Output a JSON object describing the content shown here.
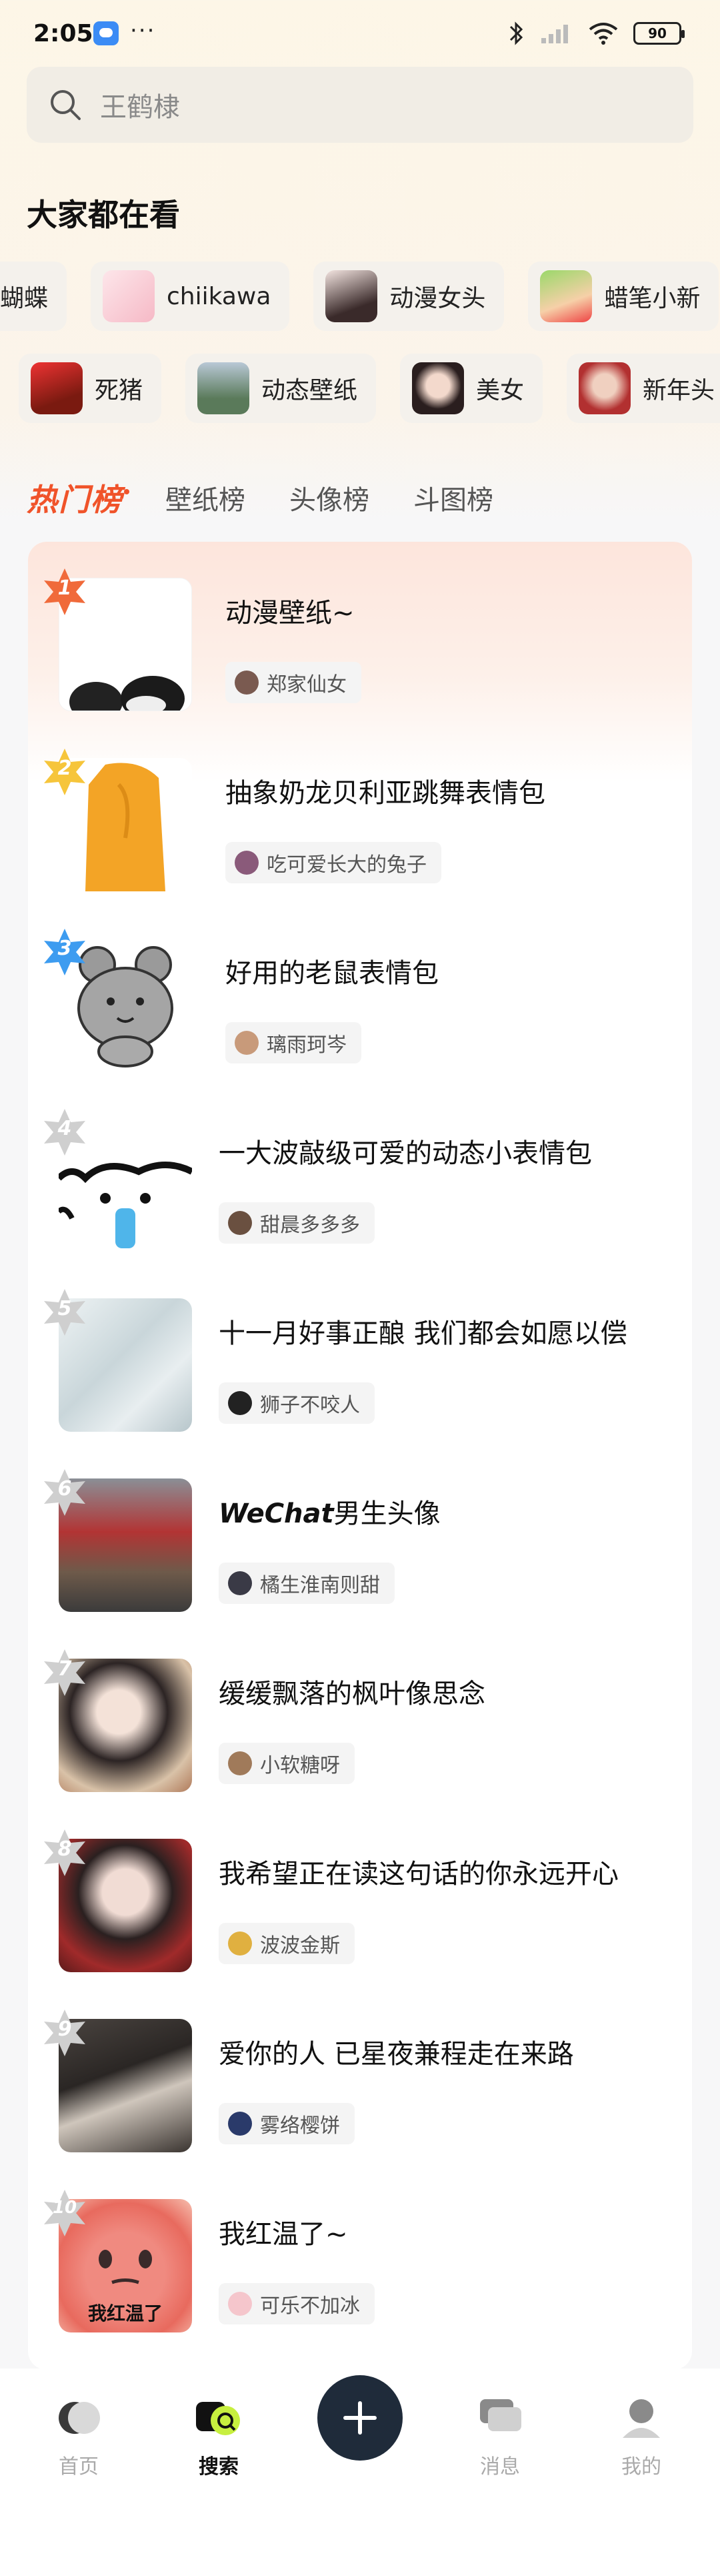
{
  "status_bar": {
    "time": "2:05",
    "dots": "···",
    "battery": "90"
  },
  "search": {
    "placeholder": "王鹤棣"
  },
  "section_title": "大家都在看",
  "chips_row1": [
    {
      "label": "蝴蝶"
    },
    {
      "label": "chiikawa"
    },
    {
      "label": "动漫女头"
    },
    {
      "label": "蜡笔小新"
    }
  ],
  "chips_row2": [
    {
      "label": "死猪"
    },
    {
      "label": "动态壁纸"
    },
    {
      "label": "美女"
    },
    {
      "label": "新年头"
    }
  ],
  "tabs": {
    "hot": "热门榜",
    "items": [
      "壁纸榜",
      "头像榜",
      "斗图榜"
    ]
  },
  "ranking": [
    {
      "rank": "1",
      "title": "动漫壁纸~",
      "author": "郑家仙女",
      "badge_color": "#f06a3a"
    },
    {
      "rank": "2",
      "title": "抽象奶龙贝利亚跳舞表情包",
      "author": "吃可爱长大的兔子",
      "badge_color": "#f6c53b"
    },
    {
      "rank": "3",
      "title": "好用的老鼠表情包",
      "author": "璃雨珂岑",
      "badge_color": "#3d9cf0"
    },
    {
      "rank": "4",
      "title": "一大波敲级可爱的动态小表情包",
      "author": "甜晨多多多",
      "badge_color": "#cfcfcf"
    },
    {
      "rank": "5",
      "title": "十一月好事正酿 我们都会如愿以偿",
      "author": "狮子不咬人",
      "badge_color": "#cfcfcf"
    },
    {
      "rank": "6",
      "title_prefix": "WeChat",
      "title": "男生头像",
      "author": "橘生淮南则甜",
      "badge_color": "#cfcfcf"
    },
    {
      "rank": "7",
      "title": "缓缓飘落的枫叶像思念",
      "author": "小软糖呀",
      "badge_color": "#cfcfcf"
    },
    {
      "rank": "8",
      "title": "我希望正在读这句话的你永远开心",
      "author": "波波金斯",
      "badge_color": "#cfcfcf"
    },
    {
      "rank": "9",
      "title": "爱你的人 已星夜兼程走在来路",
      "author": "雾络樱饼",
      "badge_color": "#cfcfcf"
    },
    {
      "rank": "10",
      "title": "我红温了~",
      "author": "可乐不加冰",
      "badge_color": "#cfcfcf",
      "thumb_text": "我红温了"
    }
  ],
  "nav": {
    "home": "首页",
    "search": "搜索",
    "messages": "消息",
    "mine": "我的"
  },
  "colors": {
    "accent": "#f0532a",
    "fab": "#1f2b3a"
  }
}
